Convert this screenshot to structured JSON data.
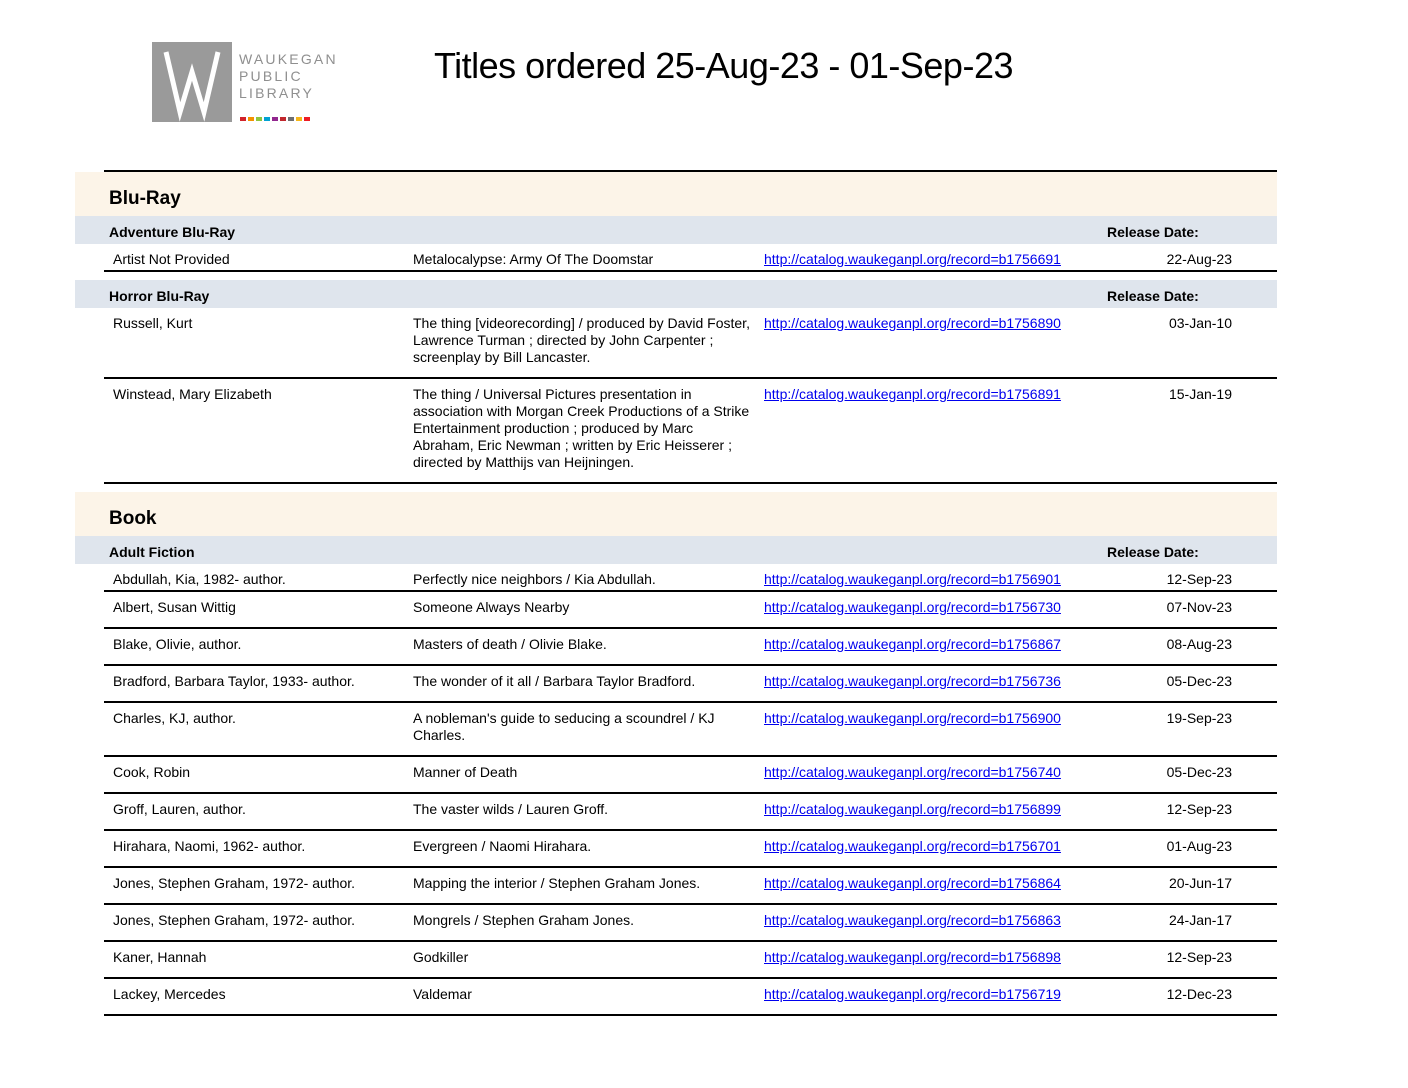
{
  "logo": {
    "lines": [
      "WAUKEGAN",
      "PUBLIC",
      "LIBRARY"
    ],
    "colors": [
      "#d2232a",
      "#f39200",
      "#8dc63f",
      "#00a2d3",
      "#92278f",
      "#c1272d",
      "#6d6e71",
      "#f7b718",
      "#ed1c24"
    ]
  },
  "page_title": "Titles ordered 25-Aug-23 - 01-Sep-23",
  "sections": [
    {
      "name": "Blu-Ray",
      "categories": [
        {
          "name": "Adventure Blu-Ray",
          "release_label": "Release Date:",
          "rows": [
            {
              "author": "Artist Not Provided",
              "title": "Metalocalypse: Army Of The Doomstar",
              "link": "http://catalog.waukeganpl.org/record=b1756691",
              "date": "22-Aug-23"
            }
          ]
        },
        {
          "name": "Horror Blu-Ray",
          "release_label": "Release Date:",
          "rows": [
            {
              "author": "Russell, Kurt",
              "title": "The thing [videorecording] / produced by David Foster, Lawrence Turman ; directed by John Carpenter ; screenplay by Bill Lancaster.",
              "link": "http://catalog.waukeganpl.org/record=b1756890",
              "date": "03-Jan-10"
            },
            {
              "author": "Winstead, Mary Elizabeth",
              "title": "The thing / Universal Pictures presentation in association with Morgan Creek Productions of a Strike Entertainment production ; produced by Marc Abraham, Eric Newman ; written by Eric Heisserer ; directed by Matthijs van Heijningen.",
              "link": "http://catalog.waukeganpl.org/record=b1756891",
              "date": "15-Jan-19"
            }
          ]
        }
      ]
    },
    {
      "name": "Book",
      "categories": [
        {
          "name": "Adult Fiction",
          "release_label": "Release Date:",
          "rows": [
            {
              "author": "Abdullah, Kia, 1982- author.",
              "title": "Perfectly nice neighbors / Kia Abdullah.",
              "link": "http://catalog.waukeganpl.org/record=b1756901",
              "date": "12-Sep-23"
            },
            {
              "author": "Albert, Susan Wittig",
              "title": "Someone Always Nearby",
              "link": "http://catalog.waukeganpl.org/record=b1756730",
              "date": "07-Nov-23"
            },
            {
              "author": "Blake, Olivie, author.",
              "title": "Masters of death / Olivie Blake.",
              "link": "http://catalog.waukeganpl.org/record=b1756867",
              "date": "08-Aug-23"
            },
            {
              "author": "Bradford, Barbara Taylor, 1933- author.",
              "title": "The wonder of it all / Barbara Taylor Bradford.",
              "link": "http://catalog.waukeganpl.org/record=b1756736",
              "date": "05-Dec-23"
            },
            {
              "author": "Charles, KJ, author.",
              "title": "A nobleman's guide to seducing a scoundrel / KJ Charles.",
              "link": "http://catalog.waukeganpl.org/record=b1756900",
              "date": "19-Sep-23"
            },
            {
              "author": "Cook, Robin",
              "title": "Manner of Death",
              "link": "http://catalog.waukeganpl.org/record=b1756740",
              "date": "05-Dec-23"
            },
            {
              "author": "Groff, Lauren, author.",
              "title": "The vaster wilds / Lauren Groff.",
              "link": "http://catalog.waukeganpl.org/record=b1756899",
              "date": "12-Sep-23"
            },
            {
              "author": "Hirahara, Naomi, 1962- author.",
              "title": "Evergreen / Naomi Hirahara.",
              "link": "http://catalog.waukeganpl.org/record=b1756701",
              "date": "01-Aug-23"
            },
            {
              "author": "Jones, Stephen Graham, 1972- author.",
              "title": "Mapping the interior / Stephen Graham Jones.",
              "link": "http://catalog.waukeganpl.org/record=b1756864",
              "date": "20-Jun-17"
            },
            {
              "author": "Jones, Stephen Graham, 1972- author.",
              "title": "Mongrels / Stephen Graham Jones.",
              "link": "http://catalog.waukeganpl.org/record=b1756863",
              "date": "24-Jan-17"
            },
            {
              "author": "Kaner, Hannah",
              "title": "Godkiller",
              "link": "http://catalog.waukeganpl.org/record=b1756898",
              "date": "12-Sep-23"
            },
            {
              "author": "Lackey, Mercedes",
              "title": "Valdemar",
              "link": "http://catalog.waukeganpl.org/record=b1756719",
              "date": "12-Dec-23"
            }
          ]
        }
      ]
    }
  ]
}
